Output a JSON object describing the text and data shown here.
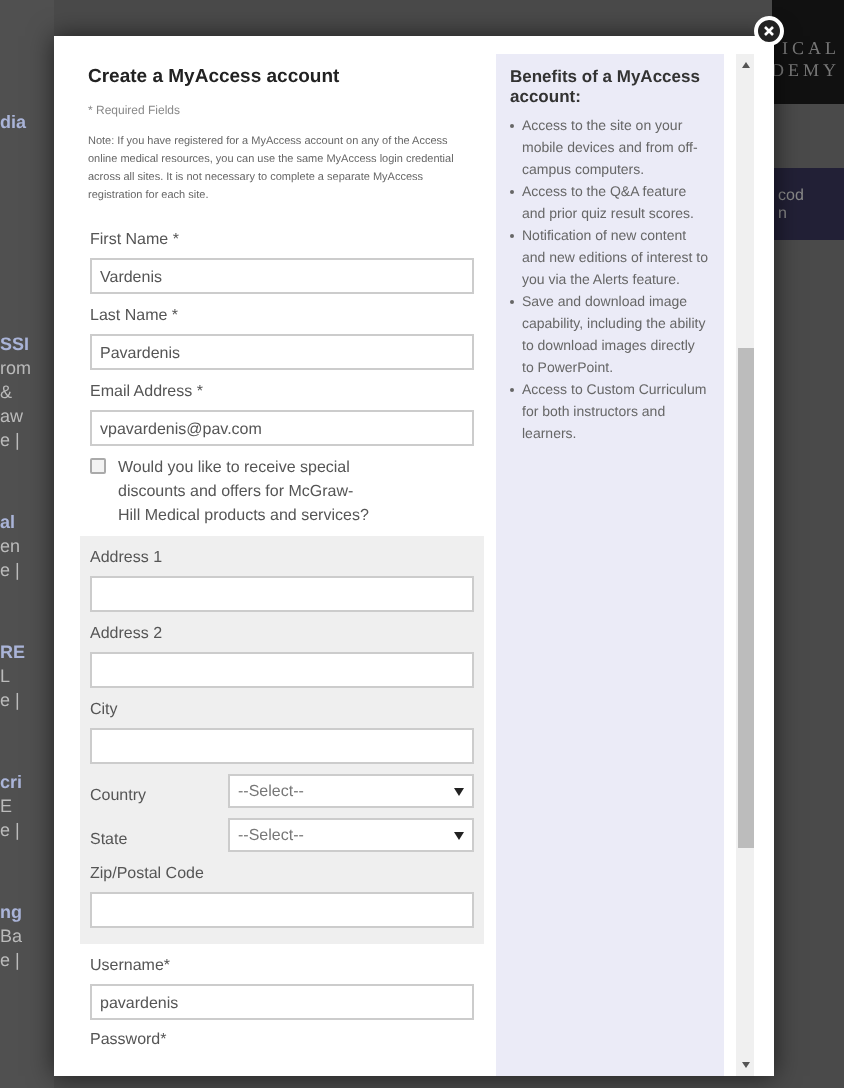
{
  "background": {
    "left_fragments": [
      [
        "dia"
      ],
      [
        "SSI",
        "rom",
        "&",
        "aw",
        "e |"
      ],
      [
        "al",
        "en",
        "e |"
      ],
      [
        "RE",
        "L",
        "e |"
      ],
      [
        "cri",
        "E",
        "e |"
      ],
      [
        "ng",
        "Ba",
        "e |"
      ]
    ],
    "right_logo": [
      "ICAL",
      "DEMY"
    ],
    "right_band": [
      "cod",
      "n"
    ]
  },
  "modal": {
    "title": "Create a MyAccess account",
    "required_note": "* Required Fields",
    "note": "Note: If you have registered for a MyAccess account on any of the Access online medical resources, you can use the same MyAccess login credential across all sites. It is not necessary to complete a separate MyAccess registration for each site.",
    "sections": [
      {
        "kind": "plain",
        "items": [
          {
            "kind": "text",
            "label": "First Name *",
            "value": "Vardenis"
          },
          {
            "kind": "text",
            "label": "Last Name *",
            "value": "Pavardenis"
          },
          {
            "kind": "text",
            "label": "Email Address *",
            "value": "vpavardenis@pav.com"
          },
          {
            "kind": "checkbox",
            "label": "Would you like to receive special discounts and offers for McGraw-Hill Medical products and services?",
            "checked": false
          }
        ]
      },
      {
        "kind": "shaded",
        "items": [
          {
            "kind": "text",
            "label": "Address 1"
          },
          {
            "kind": "text",
            "label": "Address 2"
          },
          {
            "kind": "text",
            "label": "City"
          },
          {
            "kind": "select",
            "label": "Country",
            "value": "--Select--"
          },
          {
            "kind": "select",
            "label": "State",
            "value": "--Select--"
          },
          {
            "kind": "text",
            "label": "Zip/Postal Code"
          }
        ]
      },
      {
        "kind": "plain",
        "items": [
          {
            "kind": "text",
            "label": "Username*",
            "value": "pavardenis"
          },
          {
            "kind": "label",
            "label": "Password*"
          }
        ]
      }
    ],
    "benefits": {
      "title": "Benefits of a MyAccess account:",
      "items": [
        "Access to the site on your mobile devices and from off-campus computers.",
        "Access to the Q&A feature and prior quiz result scores.",
        "Notification of new content and new editions of interest to you via the Alerts feature.",
        "Save and download image capability, including the ability to download images directly to PowerPoint.",
        "Access to Custom Curriculum for both instructors and learners."
      ]
    }
  }
}
